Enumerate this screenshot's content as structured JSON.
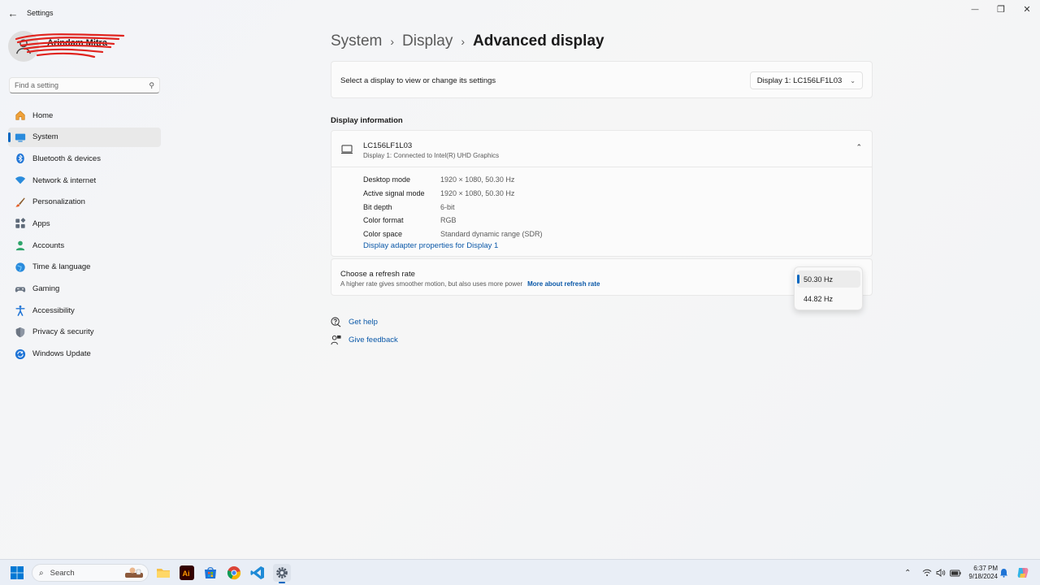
{
  "window": {
    "title": "Settings",
    "back_glyph": "←",
    "minimize_glyph": "—",
    "maximize_glyph": "❐",
    "close_glyph": "✕"
  },
  "profile": {
    "name": "Arindam Mitra",
    "subtitle": ""
  },
  "sidebar": {
    "search_placeholder": "Find a setting",
    "items": [
      {
        "label": "Home",
        "icon": "home-icon"
      },
      {
        "label": "System",
        "icon": "system-icon",
        "active": true
      },
      {
        "label": "Bluetooth & devices",
        "icon": "bluetooth-icon"
      },
      {
        "label": "Network & internet",
        "icon": "wifi-icon"
      },
      {
        "label": "Personalization",
        "icon": "brush-icon"
      },
      {
        "label": "Apps",
        "icon": "apps-icon"
      },
      {
        "label": "Accounts",
        "icon": "accounts-icon"
      },
      {
        "label": "Time & language",
        "icon": "globe-clock-icon"
      },
      {
        "label": "Gaming",
        "icon": "gamepad-icon"
      },
      {
        "label": "Accessibility",
        "icon": "accessibility-icon"
      },
      {
        "label": "Privacy & security",
        "icon": "shield-icon"
      },
      {
        "label": "Windows Update",
        "icon": "update-icon"
      }
    ]
  },
  "breadcrumb": {
    "level1": "System",
    "level2": "Display",
    "current": "Advanced display",
    "sep_glyph": "›"
  },
  "display_select": {
    "label": "Select a display to view or change its settings",
    "value": "Display 1: LC156LF1L03",
    "chevron_glyph": "⌄"
  },
  "display_info": {
    "section_title": "Display information",
    "name": "LC156LF1L03",
    "subtitle": "Display 1: Connected to Intel(R) UHD Graphics",
    "collapse_glyph": "⌃",
    "specs": [
      {
        "key": "Desktop mode",
        "value": "1920 × 1080, 50.30 Hz"
      },
      {
        "key": "Active signal mode",
        "value": "1920 × 1080, 50.30 Hz"
      },
      {
        "key": "Bit depth",
        "value": "6-bit"
      },
      {
        "key": "Color format",
        "value": "RGB"
      },
      {
        "key": "Color space",
        "value": "Standard dynamic range (SDR)"
      }
    ],
    "adapter_link": "Display adapter properties for Display 1"
  },
  "refresh_rate": {
    "title": "Choose a refresh rate",
    "subtitle": "A higher rate gives smoother motion, but also uses more power",
    "link": "More about refresh rate",
    "options": [
      "50.30 Hz",
      "44.82 Hz"
    ],
    "selected": "50.30 Hz"
  },
  "help": {
    "get_help": "Get help",
    "give_feedback": "Give feedback"
  },
  "taskbar": {
    "search_label": "Search",
    "search_glyph": "⌕",
    "tray_chevron": "⌃",
    "time": "6:37 PM",
    "date": "9/18/2024"
  },
  "colors": {
    "accent": "#0067c0",
    "link": "#0a58a8"
  }
}
